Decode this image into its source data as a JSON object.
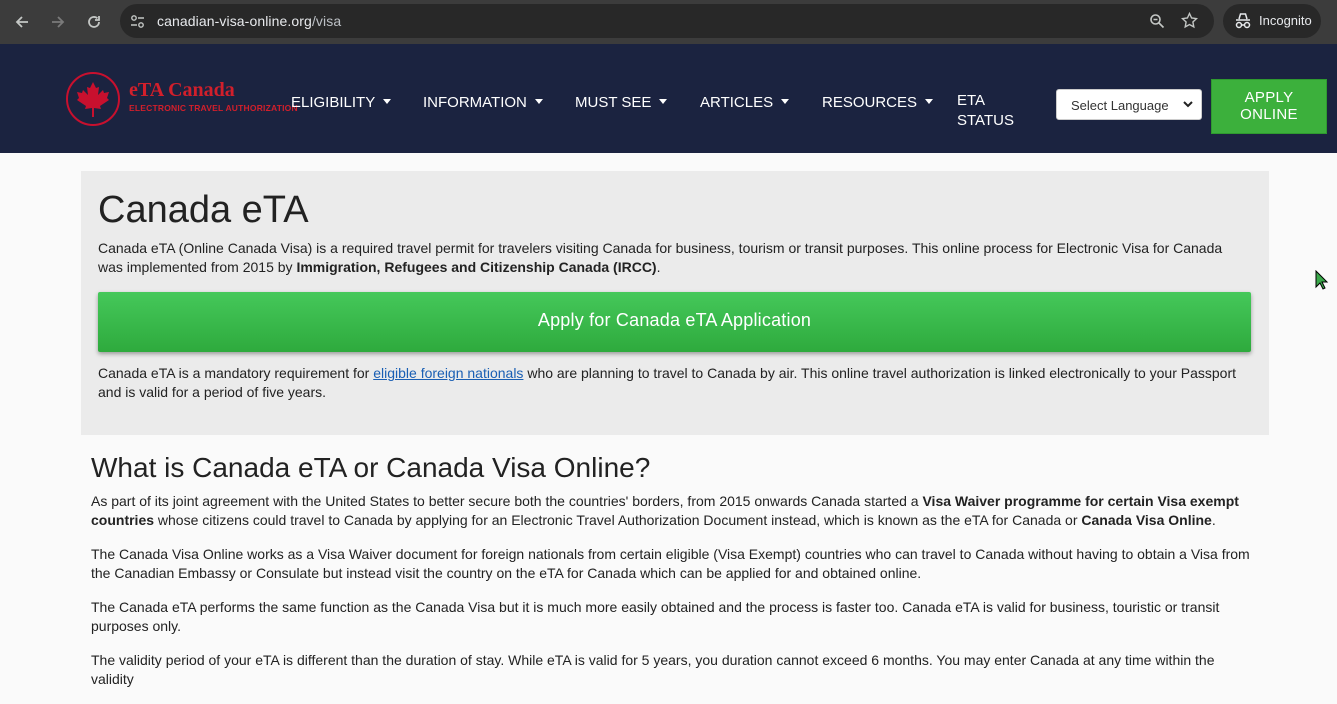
{
  "browser": {
    "url_domain": "canadian-visa-online.org",
    "url_path": "/visa",
    "incognito_label": "Incognito"
  },
  "header": {
    "logo_title": "eTA Canada",
    "logo_subtitle": "ELECTRONIC TRAVEL AUTHORIZATION",
    "menu": [
      "ELIGIBILITY",
      "INFORMATION",
      "MUST SEE",
      "ARTICLES",
      "RESOURCES"
    ],
    "eta_status_line1": "ETA",
    "eta_status_line2": "STATUS",
    "language_select": "Select Language",
    "apply_line1": "APPLY",
    "apply_line2": "ONLINE",
    "colors": {
      "header_bg": "#1b2340",
      "brand_red": "#d21f2b",
      "apply_green": "#3cb03c"
    }
  },
  "hero": {
    "title": "Canada eTA",
    "intro_text": "Canada eTA (Online Canada Visa) is a required travel permit for travelers visiting Canada for business, tourism or transit purposes. This online process for Electronic Visa for Canada was implemented from 2015 by ",
    "intro_bold": "Immigration, Refugees and Citizenship Canada (IRCC)",
    "intro_end": ".",
    "apply_button": "Apply for Canada eTA Application",
    "note_before": "Canada eTA is a mandatory requirement for ",
    "note_link": "eligible foreign nationals",
    "note_after": " who are planning to travel to Canada by air. This online travel authorization is linked electronically to your Passport and is valid for a period of five years."
  },
  "article": {
    "heading": "What is Canada eTA or Canada Visa Online?",
    "p1_a": "As part of its joint agreement with the United States to better secure both the countries' borders, from 2015 onwards Canada started a ",
    "p1_b": "Visa Waiver programme for certain Visa exempt countries",
    "p1_c": " whose citizens could travel to Canada by applying for an Electronic Travel Authorization Document instead, which is known as the eTA for Canada or ",
    "p1_d": "Canada Visa Online",
    "p1_e": ".",
    "p2": "The Canada Visa Online works as a Visa Waiver document for foreign nationals from certain eligible (Visa Exempt) countries who can travel to Canada without having to obtain a Visa from the Canadian Embassy or Consulate but instead visit the country on the eTA for Canada which can be applied for and obtained online.",
    "p3": "The Canada eTA performs the same function as the Canada Visa but it is much more easily obtained and the process is faster too. Canada eTA is valid for business, touristic or transit purposes only.",
    "p4": "The validity period of your eTA is different than the duration of stay. While eTA is valid for 5 years, you duration cannot exceed 6 months. You may enter Canada at any time within the validity"
  }
}
